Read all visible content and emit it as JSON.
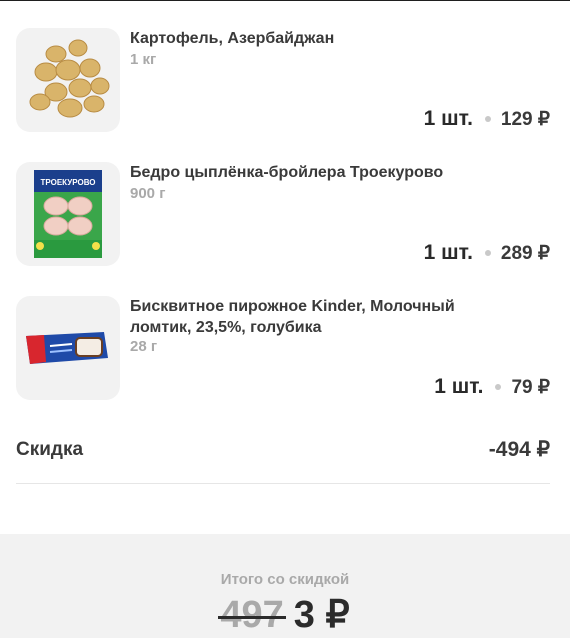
{
  "items": [
    {
      "name": "Картофель, Азербайджан",
      "weight": "1 кг",
      "quantity": "1 шт.",
      "price": "129 ₽",
      "image_icon": "potato-icon"
    },
    {
      "name": "Бедро цыплёнка-бройлера Троекурово",
      "weight": "900 г",
      "quantity": "1 шт.",
      "price": "289 ₽",
      "image_icon": "chicken-package-icon",
      "package_brand": "ТРОЕКУРОВО"
    },
    {
      "name": "Бисквитное пирожное Kinder, Молочный ломтик, 23,5%, голубика",
      "weight": "28 г",
      "quantity": "1 шт.",
      "price": "79 ₽",
      "image_icon": "kinder-bar-icon"
    }
  ],
  "discount": {
    "label": "Скидка",
    "value": "-494 ₽"
  },
  "total": {
    "label": "Итого со скидкой",
    "old_value": "497",
    "new_value": "3 ₽"
  },
  "colors": {
    "background": "#ffffff",
    "thumb_bg": "#f2f2f2",
    "panel_bg": "#f2f2f2",
    "text_primary": "#2b2b2b",
    "text_secondary": "#a9a9a9"
  }
}
